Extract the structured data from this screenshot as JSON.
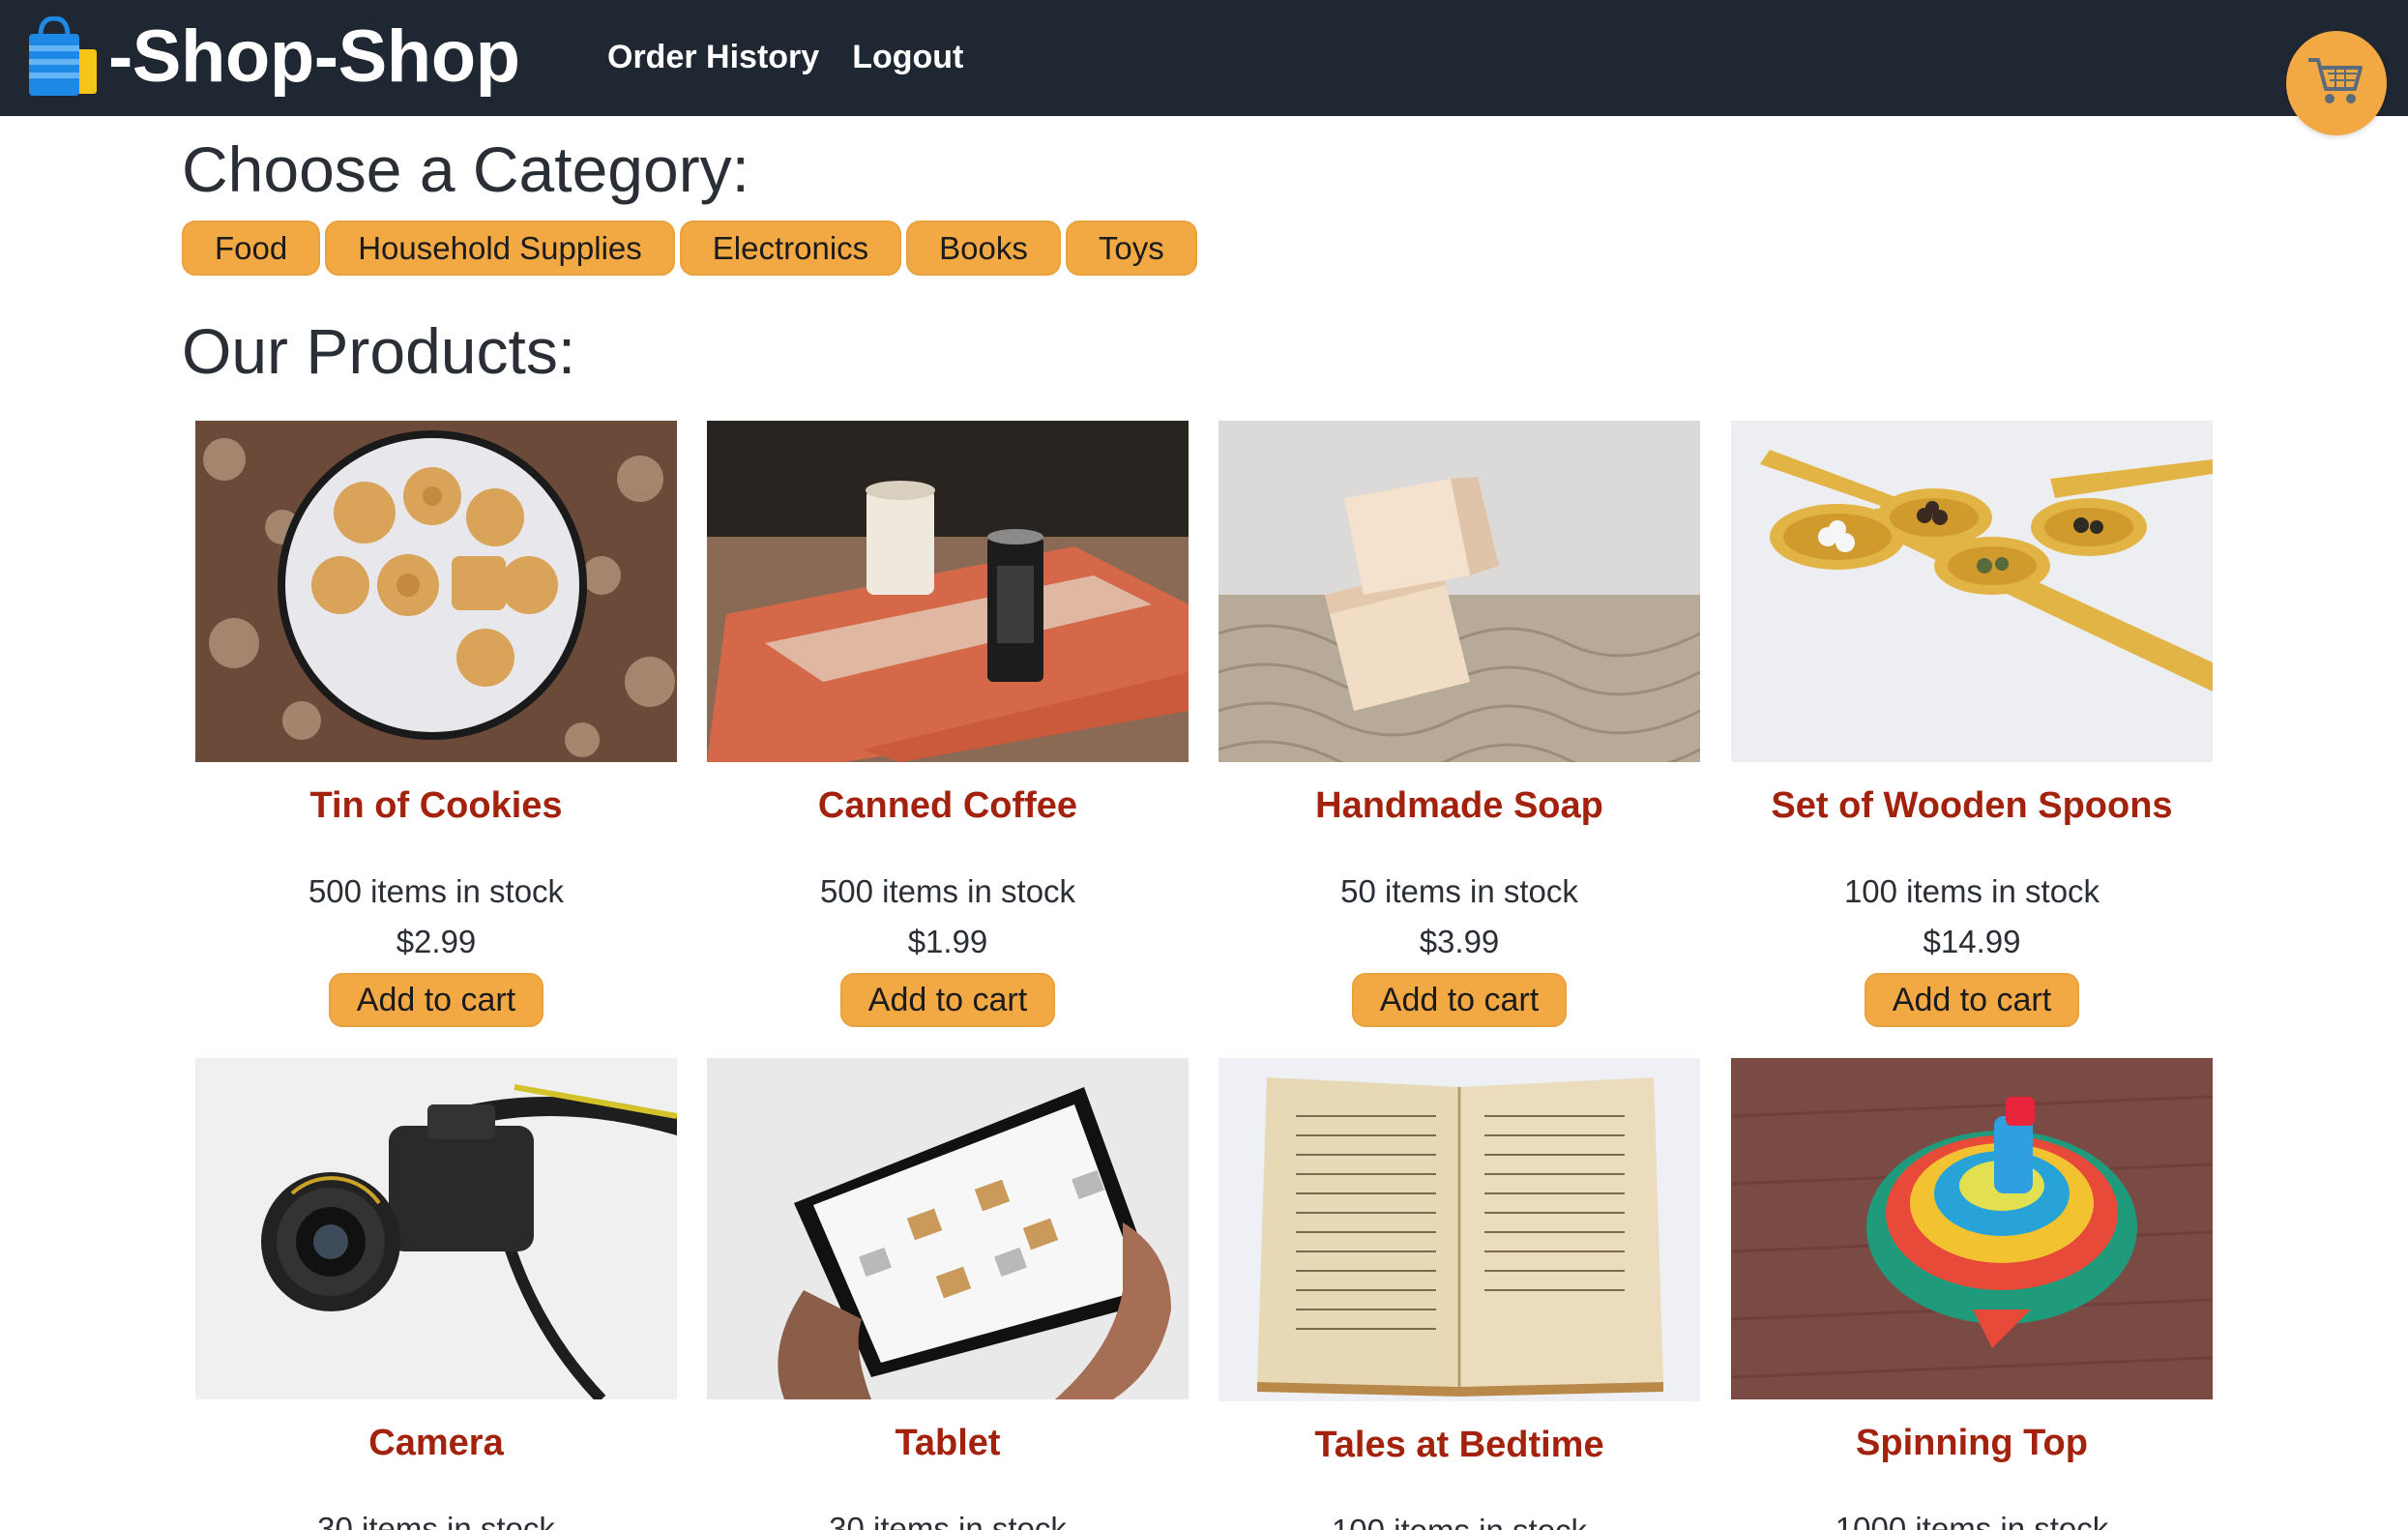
{
  "header": {
    "brand": "-Shop-Shop",
    "nav": [
      {
        "label": "Order History"
      },
      {
        "label": "Logout"
      }
    ],
    "colors": {
      "bar": "#1f2733",
      "accent": "#f2a843"
    }
  },
  "categories": {
    "title": "Choose a Category:",
    "items": [
      "Food",
      "Household Supplies",
      "Electronics",
      "Books",
      "Toys"
    ]
  },
  "products": {
    "title": "Our Products:",
    "add_label": "Add to cart",
    "items": [
      {
        "name": "Tin of Cookies",
        "stock": "500 items in stock",
        "price": "$2.99",
        "image": "cookies-tin-photo"
      },
      {
        "name": "Canned Coffee",
        "stock": "500 items in stock",
        "price": "$1.99",
        "image": "canned-coffee-photo"
      },
      {
        "name": "Handmade Soap",
        "stock": "50 items in stock",
        "price": "$3.99",
        "image": "soap-photo"
      },
      {
        "name": "Set of Wooden Spoons",
        "stock": "100 items in stock",
        "price": "$14.99",
        "image": "wooden-spoons-photo"
      },
      {
        "name": "Camera",
        "stock": "30 items in stock",
        "image": "camera-photo"
      },
      {
        "name": "Tablet",
        "stock": "30 items in stock",
        "image": "tablet-photo"
      },
      {
        "name": "Tales at Bedtime",
        "stock": "100 items in stock",
        "image": "open-book-photo"
      },
      {
        "name": "Spinning Top",
        "stock": "1000 items in stock",
        "image": "spinning-top-photo"
      }
    ]
  }
}
